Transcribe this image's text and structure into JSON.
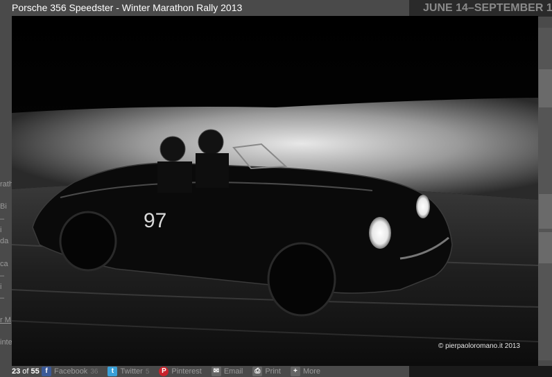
{
  "background": {
    "banner_text": "JUNE 14–SEPTEMBER 1",
    "left_fragments": [
      "rath",
      "Bi",
      "–",
      "i",
      "da",
      "ca",
      "–",
      "i",
      "–",
      "r M",
      "inte"
    ]
  },
  "lightbox": {
    "title": "Porsche 356 Speedster - Winter Marathon Rally 2013",
    "credit": "© pierpaoloromano.it  2013",
    "car_number": "97",
    "counter": {
      "current": "23",
      "sep": " of ",
      "total": "55"
    }
  },
  "share": [
    {
      "label": "Facebook",
      "count": "36",
      "icon": "facebook-icon",
      "color": "#3b5998"
    },
    {
      "label": "Twitter",
      "count": "5",
      "icon": "twitter-icon",
      "color": "#3aa0d8"
    },
    {
      "label": "Pinterest",
      "count": "",
      "icon": "pinterest-icon",
      "color": "#c8232c"
    },
    {
      "label": "Email",
      "count": "",
      "icon": "email-icon",
      "color": "#666666"
    },
    {
      "label": "Print",
      "count": "",
      "icon": "print-icon",
      "color": "#666666"
    },
    {
      "label": "More",
      "count": "",
      "icon": "more-icon",
      "color": "#666666"
    }
  ]
}
